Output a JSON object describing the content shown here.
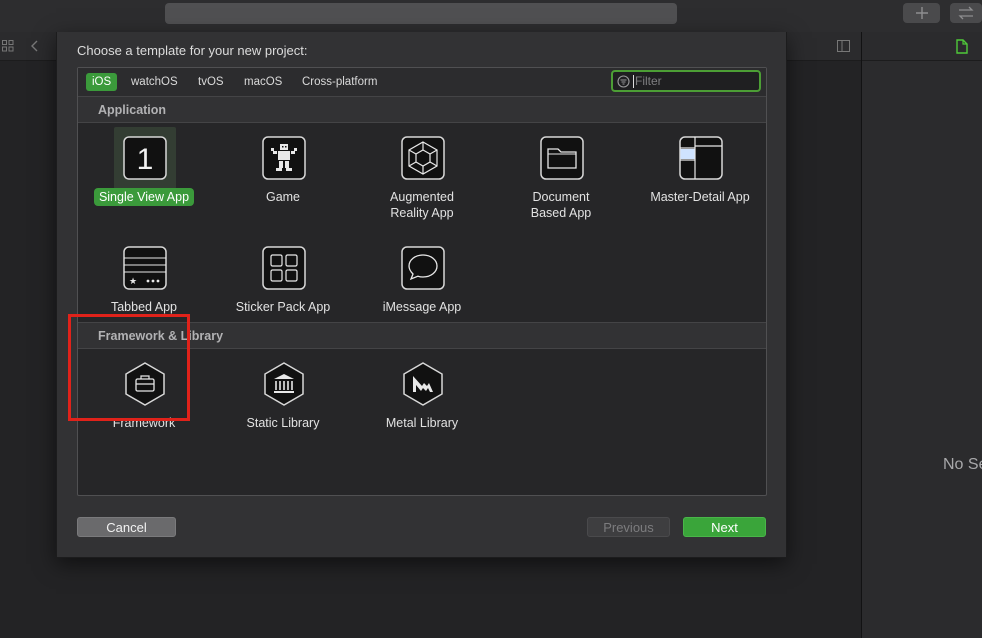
{
  "toolbar": {
    "add_icon": "plus-icon",
    "swap_icon": "arrows-swap-icon"
  },
  "inspector": {
    "placeholder_text": "No Se"
  },
  "dialog": {
    "title": "Choose a template for your new project:",
    "tabs": [
      {
        "label": "iOS",
        "selected": true
      },
      {
        "label": "watchOS"
      },
      {
        "label": "tvOS"
      },
      {
        "label": "macOS"
      },
      {
        "label": "Cross-platform"
      }
    ],
    "filter": {
      "placeholder": "Filter",
      "value": ""
    },
    "sections": [
      {
        "title": "Application",
        "templates": [
          {
            "label": "Single View App",
            "icon": "single-view-app-icon",
            "selected": true
          },
          {
            "label": "Game",
            "icon": "game-icon"
          },
          {
            "label": "Augmented Reality App",
            "label_lines": [
              "Augmented",
              "Reality App"
            ],
            "icon": "augmented-reality-icon"
          },
          {
            "label": "Document Based App",
            "label_lines": [
              "Document",
              "Based App"
            ],
            "icon": "document-folder-icon"
          },
          {
            "label": "Master-Detail App",
            "icon": "master-detail-icon"
          },
          {
            "label": "Tabbed App",
            "icon": "tabbed-app-icon"
          },
          {
            "label": "Sticker Pack App",
            "icon": "sticker-pack-icon"
          },
          {
            "label": "iMessage App",
            "icon": "imessage-bubble-icon"
          }
        ]
      },
      {
        "title": "Framework & Library",
        "templates": [
          {
            "label": "Framework",
            "icon": "framework-toolbox-icon"
          },
          {
            "label": "Static Library",
            "icon": "static-library-building-icon"
          },
          {
            "label": "Metal Library",
            "icon": "metal-library-icon"
          }
        ]
      }
    ],
    "buttons": {
      "cancel": "Cancel",
      "previous": "Previous",
      "next": "Next"
    },
    "colors": {
      "accent_green": "#3aa53a",
      "highlight_red": "#e0221a"
    }
  }
}
